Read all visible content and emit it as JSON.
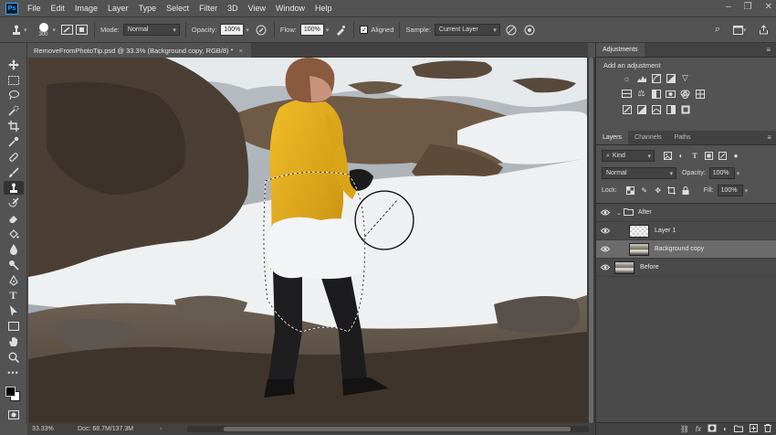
{
  "app": {
    "logo": "Ps"
  },
  "menu": [
    "File",
    "Edit",
    "Image",
    "Layer",
    "Type",
    "Select",
    "Filter",
    "3D",
    "View",
    "Window",
    "Help"
  ],
  "window_controls": [
    "–",
    "❐",
    "✕"
  ],
  "options": {
    "brush_size": "300",
    "mode_label": "Mode:",
    "mode_value": "Normal",
    "opacity_label": "Opacity:",
    "opacity_value": "100%",
    "flow_label": "Flow:",
    "flow_value": "100%",
    "aligned_label": "Aligned",
    "aligned_checked": true,
    "sample_label": "Sample:",
    "sample_value": "Current Layer"
  },
  "document": {
    "tab_title": "RemoveFromPhotoTip.psd @ 33.3% (Background copy, RGB/8) *",
    "close_symbol": "×"
  },
  "status": {
    "zoom": "33.33%",
    "doc_size": "Doc: 68.7M/137.3M"
  },
  "adjustments": {
    "tab": "Adjustments",
    "add_label": "Add an adjustment"
  },
  "layers_panel": {
    "tabs": [
      "Layers",
      "Channels",
      "Paths"
    ],
    "kind_label": "Kind",
    "blend_mode": "Normal",
    "opacity_label": "Opacity:",
    "opacity_value": "100%",
    "lock_label": "Lock:",
    "fill_label": "Fill:",
    "fill_value": "100%",
    "layers": [
      {
        "name": "After",
        "type": "group",
        "visible": true,
        "selected": false
      },
      {
        "name": "Layer 1",
        "type": "transparent",
        "visible": true,
        "selected": false
      },
      {
        "name": "Background copy",
        "type": "photo",
        "visible": true,
        "selected": true
      },
      {
        "name": "Before",
        "type": "photo",
        "visible": true,
        "selected": false
      }
    ]
  },
  "colors": {
    "panel_bg": "#535353",
    "panel_dark": "#424242",
    "selected_layer": "#6b6b6b",
    "jacket": "#e8b11c",
    "snow": "#eef0f1"
  }
}
